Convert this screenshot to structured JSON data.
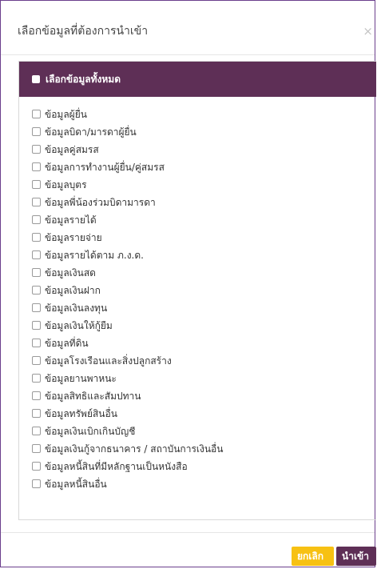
{
  "dialog": {
    "title": "เลือกข้อมูลที่ต้องการนำเข้า",
    "close_label": "×"
  },
  "panel": {
    "select_all_label": "เลือกข้อมูลทั้งหมด",
    "items": [
      "ข้อมูลผู้ยื่น",
      "ข้อมูลบิดา/มารดาผู้ยื่น",
      "ข้อมูลคู่สมรส",
      "ข้อมูลการทำงานผู้ยื่น/คู่สมรส",
      "ข้อมูลบุตร",
      "ข้อมูลพี่น้องร่วมบิดามารดา",
      "ข้อมูลรายได้",
      "ข้อมูลรายจ่าย",
      "ข้อมูลรายได้ตาม ภ.ง.ด.",
      "ข้อมูลเงินสด",
      "ข้อมูลเงินฝาก",
      "ข้อมูลเงินลงทุน",
      "ข้อมูลเงินให้กู้ยืม",
      "ข้อมูลที่ดิน",
      "ข้อมูลโรงเรือนและสิ่งปลูกสร้าง",
      "ข้อมูลยานพาหนะ",
      "ข้อมูลสิทธิและสัมปทาน",
      "ข้อมูลทรัพย์สินอื่น",
      "ข้อมูลเงินเบิกเกินบัญชี",
      "ข้อมูลเงินกู้จากธนาคาร / สถาบันการเงินอื่น",
      "ข้อมูลหนี้สินที่มีหลักฐานเป็นหนังสือ",
      "ข้อมูลหนี้สินอื่น"
    ]
  },
  "footer": {
    "cancel_label": "ยกเลิก",
    "import_label": "นำเข้า"
  },
  "colors": {
    "header_bg": "#5e2f56",
    "cancel_bg": "#f7c113",
    "import_bg": "#5e2f56"
  }
}
